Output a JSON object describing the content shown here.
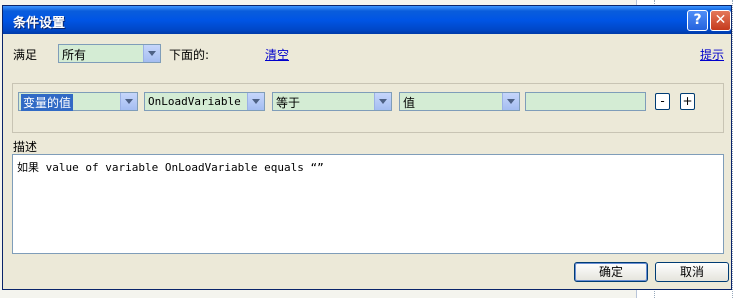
{
  "window": {
    "title": "条件设置",
    "help_label": "?",
    "close_label": "✕"
  },
  "header": {
    "satisfy_label": "满足",
    "satisfy_value": "所有",
    "below_label": "下面的:",
    "clear_link": "清空",
    "hint_link": "提示"
  },
  "condition": {
    "field_value": "变量的值",
    "variable_value": "OnLoadVariable",
    "operator_value": "等于",
    "value_type": "值",
    "value_input": "",
    "remove_label": "-",
    "add_label": "+"
  },
  "description": {
    "label": "描述",
    "text": "如果 value of variable OnLoadVariable equals “”"
  },
  "footer": {
    "ok_label": "确定",
    "cancel_label": "取消"
  },
  "colors": {
    "title_bar": "#0055e5",
    "field_bg": "#d4ecd4",
    "selection": "#316ac5",
    "link": "#0000cc"
  }
}
